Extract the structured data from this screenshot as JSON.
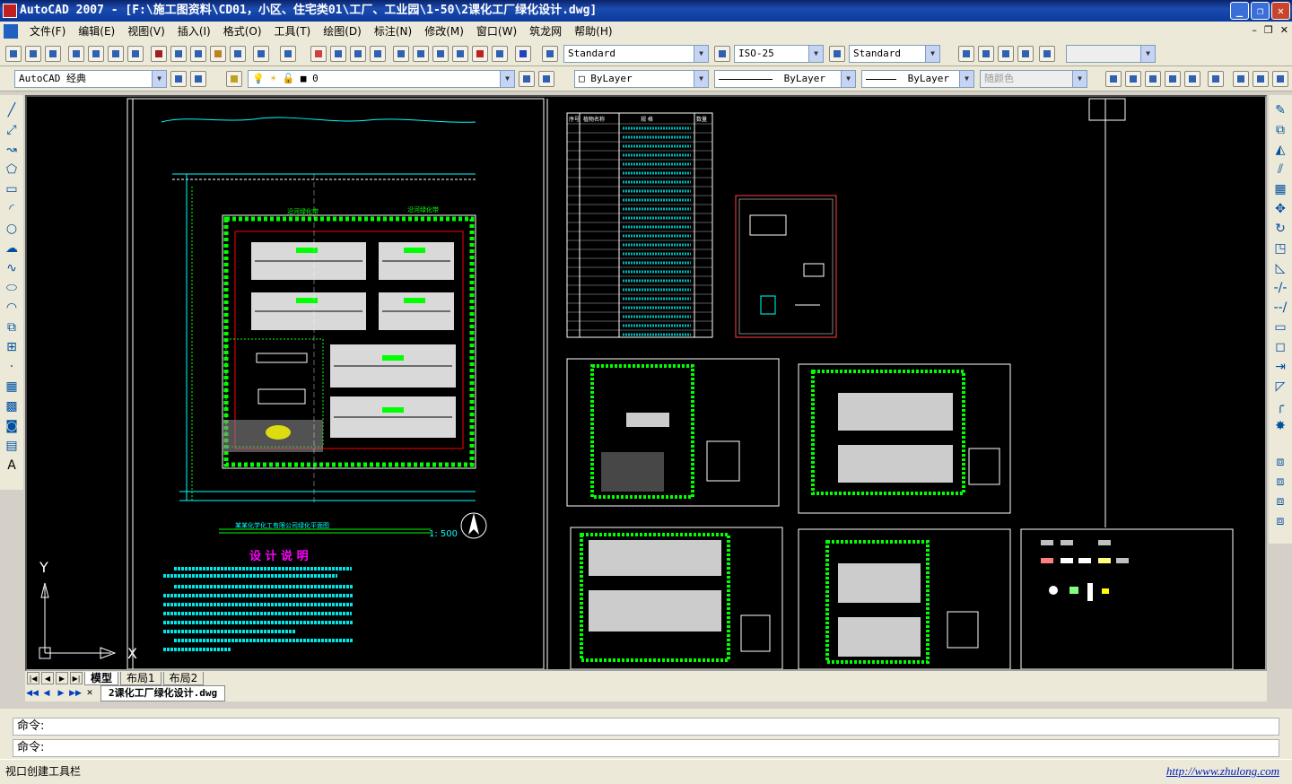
{
  "window": {
    "title": "AutoCAD 2007 - [F:\\施工图资料\\CD01，小区、住宅类01\\工厂、工业园\\1-50\\2课化工厂绿化设计.dwg]",
    "minimize": "_",
    "restore": "❐",
    "close": "✕"
  },
  "menubar": {
    "items": [
      "文件(F)",
      "编辑(E)",
      "视图(V)",
      "插入(I)",
      "格式(O)",
      "工具(T)",
      "绘图(D)",
      "标注(N)",
      "修改(M)",
      "窗口(W)",
      "筑龙网",
      "帮助(H)"
    ],
    "mdi_minimize": "–",
    "mdi_restore": "❐",
    "mdi_close": "✕"
  },
  "toolbar1": {
    "text_style": "Standard",
    "dim_style": "ISO-25",
    "table_style": "Standard"
  },
  "toolbar2": {
    "workspace": "AutoCAD 经典",
    "layer": "0",
    "color": "ByLayer",
    "linetype": "ByLayer",
    "lineweight": "ByLayer",
    "plotstyle": "随颜色"
  },
  "drawing": {
    "plan_title": "某某化学化工有限公司绿化平面图",
    "scale": "1: 500",
    "notes_title": "设 计 说 明",
    "band_label_1": "沿河绿化带",
    "band_label_2": "沿河绿化带",
    "ucs_y": "Y",
    "ucs_x": "X",
    "table_headers": [
      "序号",
      "植物名称",
      "规    格",
      "数量"
    ]
  },
  "layout_tabs": {
    "tabs": [
      "模型",
      "布局1",
      "布局2"
    ]
  },
  "doc_tabs": {
    "active": "2课化工厂绿化设计.dwg"
  },
  "command": {
    "line1": "命令:",
    "line2": "命令:"
  },
  "status": {
    "text": "视口创建工具栏",
    "url": "http://www.zhulong.com"
  },
  "colors": {
    "canvas": "#000000",
    "title_bar": "#0a246a",
    "cad_green": "#00ff00",
    "cad_cyan": "#00ffff",
    "cad_red": "#ff0000",
    "cad_white": "#ffffff"
  }
}
